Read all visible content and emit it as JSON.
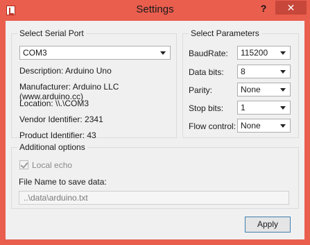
{
  "window": {
    "title": "Settings",
    "help": "?",
    "close": "✕"
  },
  "serial_port": {
    "group_title": "Select Serial Port",
    "port": "COM3",
    "description": "Description: Arduino Uno",
    "manufacturer": "Manufacturer: Arduino LLC (www.arduino.cc)",
    "location": "Location: \\\\.\\COM3",
    "vendor_id": "Vendor Identifier: 2341",
    "product_id": "Product Identifier: 43"
  },
  "parameters": {
    "group_title": "Select Parameters",
    "baud_label": "BaudRate:",
    "baud_value": "115200",
    "data_bits_label": "Data bits:",
    "data_bits_value": "8",
    "parity_label": "Parity:",
    "parity_value": "None",
    "stop_bits_label": "Stop bits:",
    "stop_bits_value": "1",
    "flow_label": "Flow control:",
    "flow_value": "None"
  },
  "additional": {
    "group_title": "Additional options",
    "local_echo_label": "Local echo",
    "local_echo_checked": true,
    "file_label": "File Name to save data:",
    "file_value": "..\\data\\arduino.txt"
  },
  "footer": {
    "apply_label": "Apply"
  },
  "colors": {
    "titlebar": "#ea5e4e",
    "close_hover": "#c7473a",
    "panel": "#f0f0f0",
    "accent_border": "#3c7fb1"
  }
}
